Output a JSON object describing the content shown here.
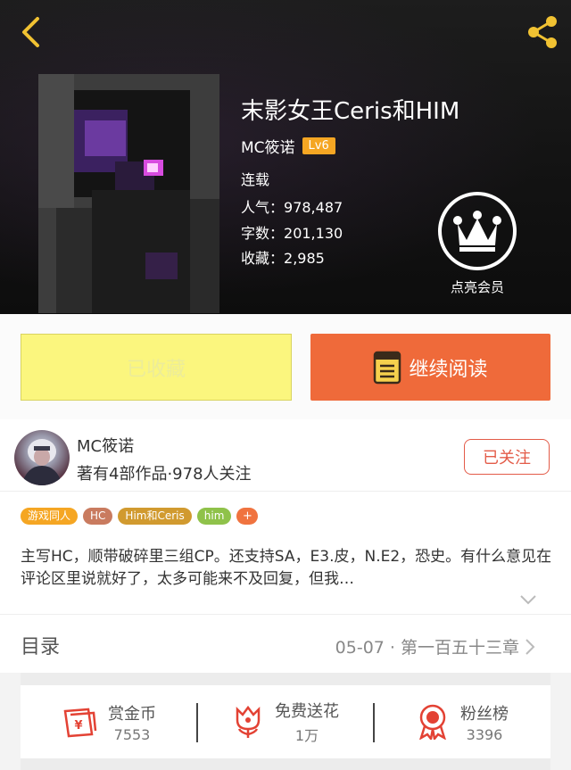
{
  "header": {
    "title": "末影女王Ceris和HIM",
    "author": "MC筱诺",
    "level": "Lv6",
    "status": "连载",
    "popularity_label": "人气：",
    "popularity": "978,487",
    "words_label": "字数：",
    "words": "201,130",
    "favorites_label": "收藏：",
    "favorites": "2,985",
    "vip_label": "点亮会员"
  },
  "actions": {
    "collected_label": "已收藏",
    "continue_label": "继续阅读"
  },
  "author_card": {
    "name": "MC筱诺",
    "info": "著有4部作品·978人关注",
    "follow_label": "已关注"
  },
  "tags": [
    {
      "label": "游戏同人",
      "color": "#f5a623"
    },
    {
      "label": "HC",
      "color": "#c97b5f"
    },
    {
      "label": "Him和Ceris",
      "color": "#d19a2f"
    },
    {
      "label": "him",
      "color": "#8fc24a"
    },
    {
      "label": "+",
      "color": "#f0733f"
    }
  ],
  "description": "主写HC，顺带破碎里三组CP。还支持SA，E3.皮，N.E2，恐史。有什么意见在评论区里说就好了，太多可能来不及回复，但我…",
  "toc": {
    "title": "目录",
    "latest": "05-07 · 第一百五十三章"
  },
  "stats": [
    {
      "label": "赏金币",
      "value": "7553",
      "icon": "reward-coin-icon"
    },
    {
      "label": "免费送花",
      "value": "1万",
      "icon": "flower-icon"
    },
    {
      "label": "粉丝榜",
      "value": "3396",
      "icon": "medal-icon"
    }
  ],
  "colors": {
    "accent_orange": "#ef6a3a",
    "collected_yellow": "#fbf67e",
    "follow_red": "#e35b48",
    "back_arrow": "#f1c232",
    "share": "#f1c232"
  }
}
